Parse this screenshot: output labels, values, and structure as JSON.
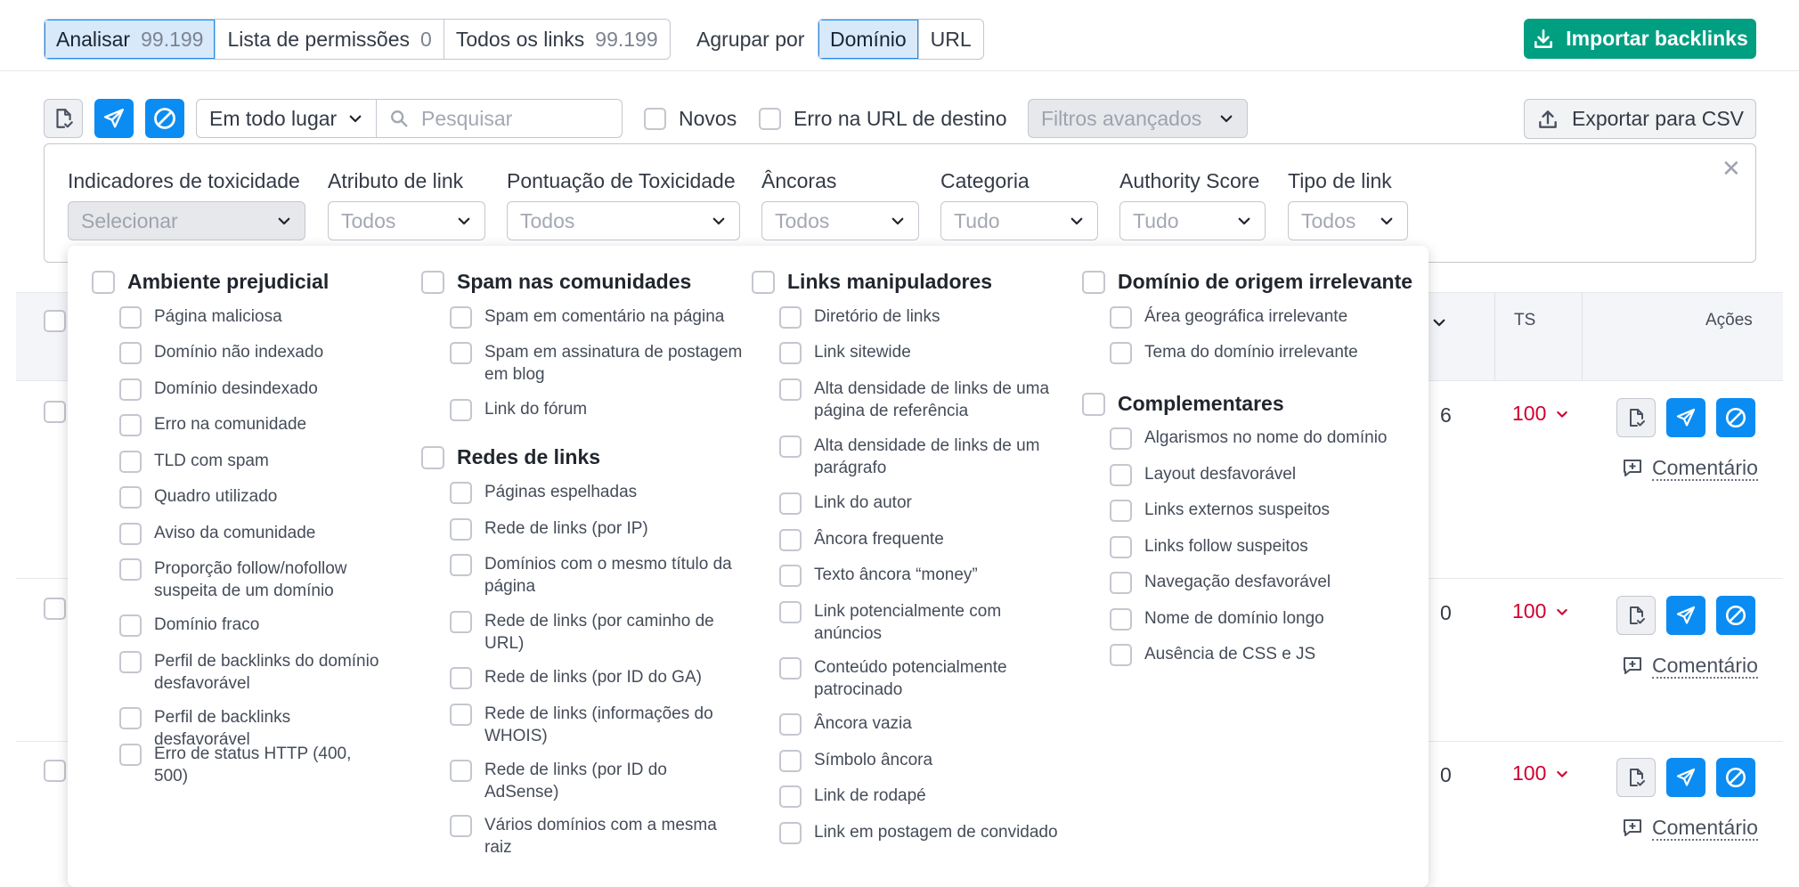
{
  "top": {
    "seg1": [
      {
        "label": "Analisar",
        "count": "99.199",
        "active": true
      },
      {
        "label": "Lista de permissões",
        "count": "0"
      },
      {
        "label": "Todos os links",
        "count": "99.199"
      }
    ],
    "group_by_label": "Agrupar por",
    "group_by": [
      {
        "label": "Domínio",
        "active": true
      },
      {
        "label": "URL"
      }
    ],
    "import_label": "Importar backlinks"
  },
  "toolbar": {
    "location_select": "Em todo lugar",
    "search_placeholder": "Pesquisar",
    "new_label": "Novos",
    "target_error_label": "Erro na URL de destino",
    "advanced_filters": "Filtros avançados",
    "export_label": "Exportar para CSV"
  },
  "filters": [
    {
      "label": "Indicadores de toxicidade",
      "value": "Selecionar"
    },
    {
      "label": "Atributo de link",
      "value": "Todos"
    },
    {
      "label": "Pontuação de Toxicidade",
      "value": "Todos"
    },
    {
      "label": "Âncoras",
      "value": "Todos"
    },
    {
      "label": "Categoria",
      "value": "Tudo"
    },
    {
      "label": "Authority Score",
      "value": "Tudo"
    },
    {
      "label": "Tipo de link",
      "value": "Todos"
    }
  ],
  "table": {
    "ts_header": "TS",
    "actions_header": "Ações",
    "rows": [
      {
        "num": "6",
        "ts": "100",
        "comment": "Comentário"
      },
      {
        "num": "0",
        "ts": "100",
        "comment": "Comentário"
      },
      {
        "num": "0",
        "ts": "100",
        "comment": "Comentário"
      }
    ]
  },
  "toxicity": {
    "col1": {
      "g1": "Ambiente prejudicial",
      "g1_items": [
        "Página maliciosa",
        "Domínio não indexado",
        "Domínio desindexado",
        "Erro na comunidade",
        "TLD com spam",
        "Quadro utilizado",
        "Aviso da comunidade",
        "Proporção follow/nofollow suspeita de um domínio",
        "Domínio fraco",
        "Perfil de backlinks do domínio desfavorável",
        "Perfil de backlinks desfavorável",
        "Erro de status HTTP (400, 500)"
      ]
    },
    "col2": {
      "g1": "Spam nas comunidades",
      "g1_items": [
        "Spam em comentário na página",
        "Spam em assinatura de postagem em blog",
        "Link do fórum"
      ],
      "g2": "Redes de links",
      "g2_items": [
        "Páginas espelhadas",
        "Rede de links (por IP)",
        "Domínios com o mesmo título da página",
        "Rede de links (por caminho de URL)",
        "Rede de links (por ID do GA)",
        "Rede de links (informações do WHOIS)",
        "Rede de links (por ID do AdSense)",
        "Vários domínios com a mesma raiz"
      ]
    },
    "col3": {
      "g1": "Links manipuladores",
      "g1_items": [
        "Diretório de links",
        "Link sitewide",
        "Alta densidade de links de uma página de referência",
        "Alta densidade de links de um parágrafo",
        "Link do autor",
        "Âncora frequente",
        "Texto âncora “money”",
        "Link potencialmente com anúncios",
        "Conteúdo potencialmente patrocinado",
        "Âncora vazia",
        "Símbolo âncora",
        "Link de rodapé",
        "Link em postagem de convidado"
      ]
    },
    "col4": {
      "g1": "Domínio de origem irrelevante",
      "g1_items": [
        "Área geográfica irrelevante",
        "Tema do domínio irrelevante"
      ],
      "g2": "Complementares",
      "g2_items": [
        "Algarismos no nome do domínio",
        "Layout desfavorável",
        "Links externos suspeitos",
        "Links follow suspeitos",
        "Navegação desfavorável",
        "Nome de domínio longo",
        "Ausência de CSS e JS"
      ]
    }
  }
}
